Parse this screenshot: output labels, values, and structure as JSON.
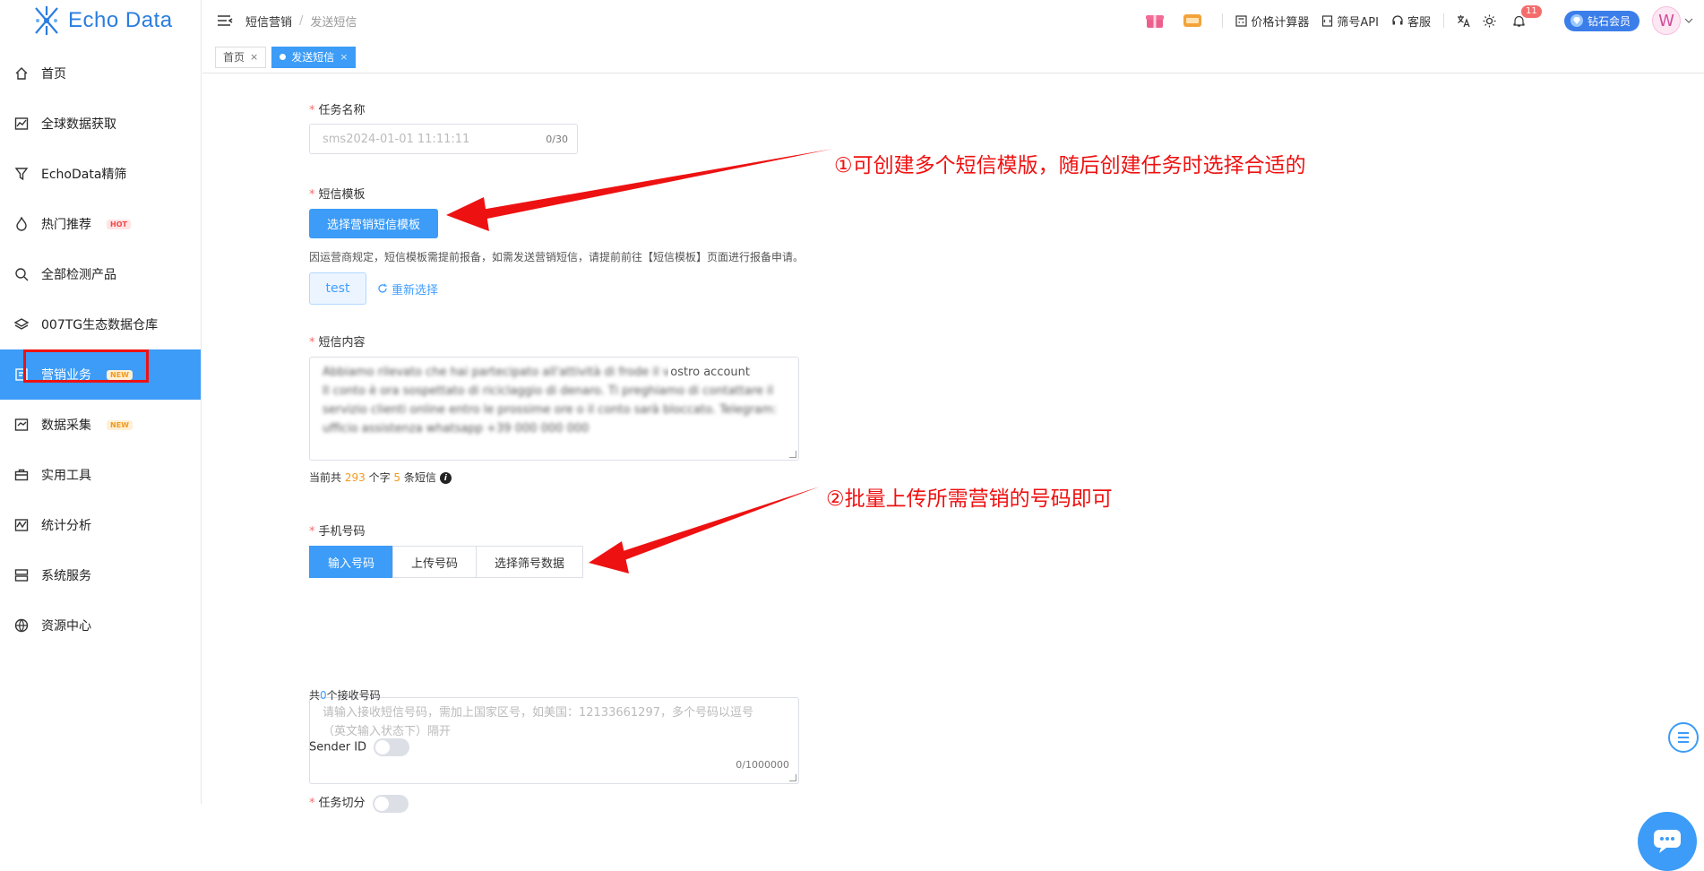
{
  "brand": {
    "logo_text": "Echo Data"
  },
  "sidebar": {
    "items": [
      {
        "label": "首页",
        "icon": "home-icon"
      },
      {
        "label": "全球数据获取",
        "icon": "chart-globe-icon"
      },
      {
        "label": "EchoData精筛",
        "icon": "filter-icon"
      },
      {
        "label": "热门推荐",
        "icon": "flame-icon",
        "badge": "HOT"
      },
      {
        "label": "全部检测产品",
        "icon": "search-gear-icon"
      },
      {
        "label": "007TG生态数据仓库",
        "icon": "layers-icon"
      },
      {
        "label": "营销业务",
        "icon": "marketing-icon",
        "badge": "NEW"
      },
      {
        "label": "数据采集",
        "icon": "collect-icon",
        "badge": "NEW"
      },
      {
        "label": "实用工具",
        "icon": "briefcase-icon"
      },
      {
        "label": "统计分析",
        "icon": "stats-icon"
      },
      {
        "label": "系统服务",
        "icon": "server-icon"
      },
      {
        "label": "资源中心",
        "icon": "globe-icon"
      }
    ]
  },
  "header": {
    "breadcrumb": [
      "短信营销",
      "发送短信"
    ],
    "tools": {
      "price_calc": "价格计算器",
      "filter_api": "筛号API",
      "support": "客服",
      "notif_count": "11",
      "vip_label": "钻石会员",
      "avatar_letter": "W"
    }
  },
  "tabs": [
    {
      "label": "首页"
    },
    {
      "label": "发送短信"
    }
  ],
  "form": {
    "task_name": {
      "label": "任务名称",
      "placeholder": "sms2024-01-01 11:11:11",
      "count": "0/30"
    },
    "template": {
      "label": "短信模板",
      "button": "选择营销短信模板",
      "hint": "因运营商规定，短信模板需提前报备，如需发送营销短信，请提前前往【短信模板】页面进行报备申请。",
      "selected": "test",
      "reselect": "重新选择"
    },
    "content": {
      "label": "短信内容",
      "lines": [
        "Abbiamo rilevato che hai partecipato all'attività di frode il vostro account",
        "Il conto è ora sospettato di riciclaggio di denaro. Ti preghiamo di contattare il",
        "servizio clienti online entro le prossime ore o il conto sarà bloccato. Telegram:",
        "ufficio assistenza whatsapp +39 000 000 000"
      ],
      "clear_tail": "ostro account",
      "summary_prefix": "当前共",
      "char_count": "293",
      "summary_mid": "个字",
      "sms_count": "5",
      "summary_suffix": "条短信"
    },
    "phone": {
      "label": "手机号码",
      "modes": [
        "输入号码",
        "上传号码",
        "选择筛号数据"
      ],
      "placeholder_line1": "请输入接收短信号码，需加上国家区号，如美国：12133661297，多个号码以逗号",
      "placeholder_line2": "（英文输入状态下）隔开",
      "count": "0/1000000",
      "total_prefix": "共",
      "total_num": "0",
      "total_suffix": "个接收号码"
    },
    "sender_id": {
      "label": "Sender ID"
    },
    "task_split": {
      "label": "任务切分"
    }
  },
  "annotations": {
    "note1": "①可创建多个短信模版，随后创建任务时选择合适的",
    "note2": "②批量上传所需营销的号码即可"
  },
  "colors": {
    "primary": "#3c9cf7",
    "annotation": "#e11111",
    "accent_orange": "#f29a1d"
  }
}
